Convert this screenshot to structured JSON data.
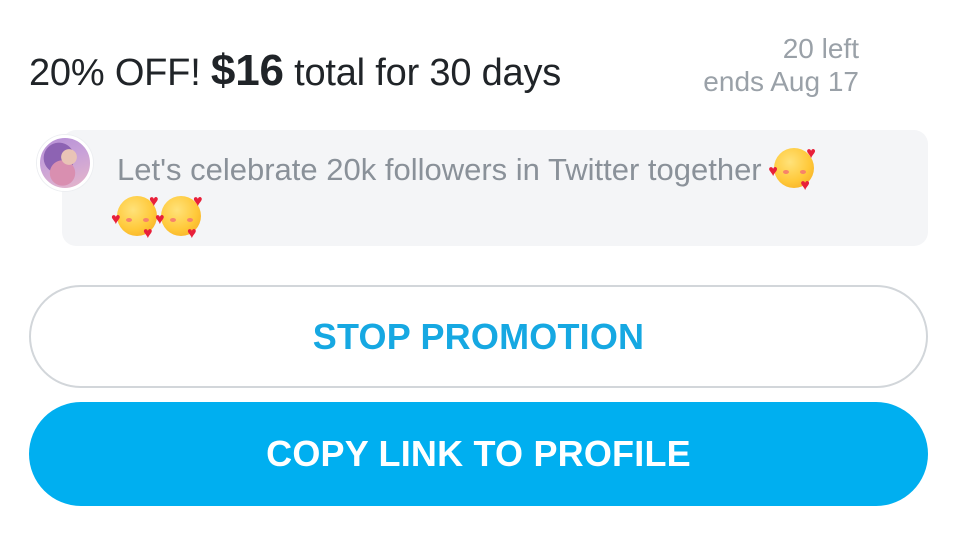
{
  "offer": {
    "discount": "20% OFF!",
    "price": "$16",
    "terms": "total for 30 days",
    "remaining": "20 left",
    "ends": "ends Aug 17"
  },
  "message": {
    "avatar_icon": "user-avatar",
    "text": "Let's celebrate 20k followers in Twitter together",
    "emoji_icon": "smiling-face-with-hearts-emoji"
  },
  "actions": {
    "stop_label": "STOP PROMOTION",
    "copy_label": "COPY LINK TO PROFILE"
  },
  "colors": {
    "accent": "#00aff0",
    "outline_text": "#16a8e2",
    "muted_text": "#9aa1a8",
    "bubble_bg": "#f4f5f7"
  }
}
